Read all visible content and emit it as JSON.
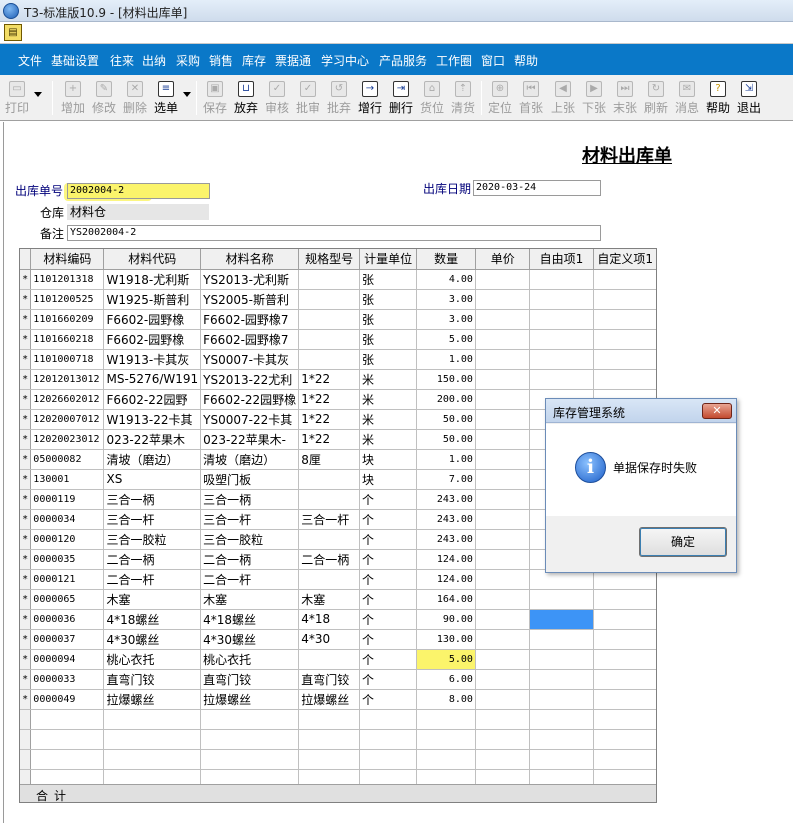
{
  "window": {
    "title": "T3-标准版10.9 - [材料出库单]"
  },
  "menu": [
    "文件",
    "基础设置",
    "往来",
    "出纳",
    "采购",
    "销售",
    "库存",
    "票据通",
    "学习中心",
    "产品服务",
    "工作圈",
    "窗口",
    "帮助"
  ],
  "toolbar": {
    "print": "打印",
    "add": "增加",
    "edit": "修改",
    "delete": "删除",
    "select": "选单",
    "save": "保存",
    "discard": "放弃",
    "audit": "审核",
    "approve": "批审",
    "abandon": "批弃",
    "add_row": "增行",
    "del_row": "删行",
    "locate_stock": "货位",
    "clear": "清货",
    "position": "定位",
    "first": "首张",
    "prev": "上张",
    "next": "下张",
    "last": "末张",
    "refresh": "刷新",
    "message": "消息",
    "help": "帮助",
    "exit": "退出"
  },
  "form": {
    "title": "材料出库单",
    "doc_no_label": "出库单号",
    "doc_no": "2002004-2",
    "date_label": "出库日期",
    "date": "2020-03-24",
    "warehouse_label": "仓库",
    "warehouse": "材料仓",
    "remark_label": "备注",
    "remark": "YS2002004-2"
  },
  "grid": {
    "headers": [
      "材料编码",
      "材料代码",
      "材料名称",
      "规格型号",
      "计量单位",
      "数量",
      "单价",
      "自由项1",
      "自定义项1"
    ],
    "row_marker": "*",
    "rows": [
      [
        "1101201318",
        "W1918-尤利斯",
        "YS2013-尤利斯",
        "",
        "张",
        "4.00"
      ],
      [
        "1101200525",
        "W1925-斯普利",
        "YS2005-斯普利",
        "",
        "张",
        "3.00"
      ],
      [
        "1101660209",
        "F6602-园野橡",
        "F6602-园野橡7",
        "",
        "张",
        "3.00"
      ],
      [
        "1101660218",
        "F6602-园野橡",
        "F6602-园野橡7",
        "",
        "张",
        "5.00"
      ],
      [
        "1101000718",
        "W1913-卡其灰",
        "YS0007-卡其灰",
        "",
        "张",
        "1.00"
      ],
      [
        "12012013012",
        "MS-5276/W191",
        "YS2013-22尤利",
        "1*22",
        "米",
        "150.00"
      ],
      [
        "12026602012",
        "F6602-22园野",
        "F6602-22园野橡",
        "1*22",
        "米",
        "200.00"
      ],
      [
        "12020007012",
        "W1913-22卡其",
        "YS0007-22卡其",
        "1*22",
        "米",
        "50.00"
      ],
      [
        "12020023012",
        "023-22苹果木",
        "023-22苹果木-",
        "1*22",
        "米",
        "50.00"
      ],
      [
        "05000082",
        "清坡（磨边）",
        "清坡（磨边）",
        "8厘",
        "块",
        "1.00"
      ],
      [
        "130001",
        "XS",
        "吸塑门板",
        "",
        "块",
        "7.00"
      ],
      [
        "0000119",
        "三合一柄",
        "三合一柄",
        "",
        "个",
        "243.00"
      ],
      [
        "0000034",
        "三合一杆",
        "三合一杆",
        "三合一杆",
        "个",
        "243.00"
      ],
      [
        "0000120",
        "三合一胶粒",
        "三合一胶粒",
        "",
        "个",
        "243.00"
      ],
      [
        "0000035",
        "二合一柄",
        "二合一柄",
        "二合一柄",
        "个",
        "124.00"
      ],
      [
        "0000121",
        "二合一杆",
        "二合一杆",
        "",
        "个",
        "124.00"
      ],
      [
        "0000065",
        "木塞",
        "木塞",
        "木塞",
        "个",
        "164.00"
      ],
      [
        "0000036",
        "4*18螺丝",
        "4*18螺丝",
        "4*18",
        "个",
        "90.00"
      ],
      [
        "0000037",
        "4*30螺丝",
        "4*30螺丝",
        "4*30",
        "个",
        "130.00"
      ],
      [
        "0000094",
        "桃心衣托",
        "桃心衣托",
        "",
        "个",
        "5.00"
      ],
      [
        "0000033",
        "直弯门铰",
        "直弯门铰",
        "直弯门铰",
        "个",
        "6.00"
      ],
      [
        "0000049",
        "拉爆螺丝",
        "拉爆螺丝",
        "拉爆螺丝",
        "个",
        "8.00"
      ]
    ],
    "total_label": "合计"
  },
  "dialog": {
    "title": "库存管理系统",
    "message": "单据保存时失败",
    "ok": "确定",
    "close": "✕"
  },
  "colors": {
    "menubar": "#0a78c8",
    "highlight": "#fbf46b",
    "selected_cell": "#3d94f6"
  }
}
